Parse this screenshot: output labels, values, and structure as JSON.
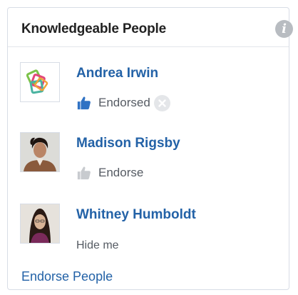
{
  "card": {
    "title": "Knowledgeable People",
    "info_icon": "info-icon",
    "footer_link": "Endorse People"
  },
  "people": [
    {
      "name": "Andrea Irwin",
      "endorse_label": "Endorsed",
      "endorsed": true,
      "avatar": "logo-avatar",
      "remove_icon": "close-circle-icon"
    },
    {
      "name": "Madison Rigsby",
      "endorse_label": "Endorse",
      "endorsed": false,
      "avatar": "photo-avatar"
    },
    {
      "name": "Whitney Humboldt",
      "action_label": "Hide me",
      "avatar": "photo-avatar"
    }
  ],
  "colors": {
    "link": "#2362a7",
    "thumb_active": "#2f72c4",
    "thumb_inactive": "#c8cbcf",
    "border": "#d8dde6"
  }
}
